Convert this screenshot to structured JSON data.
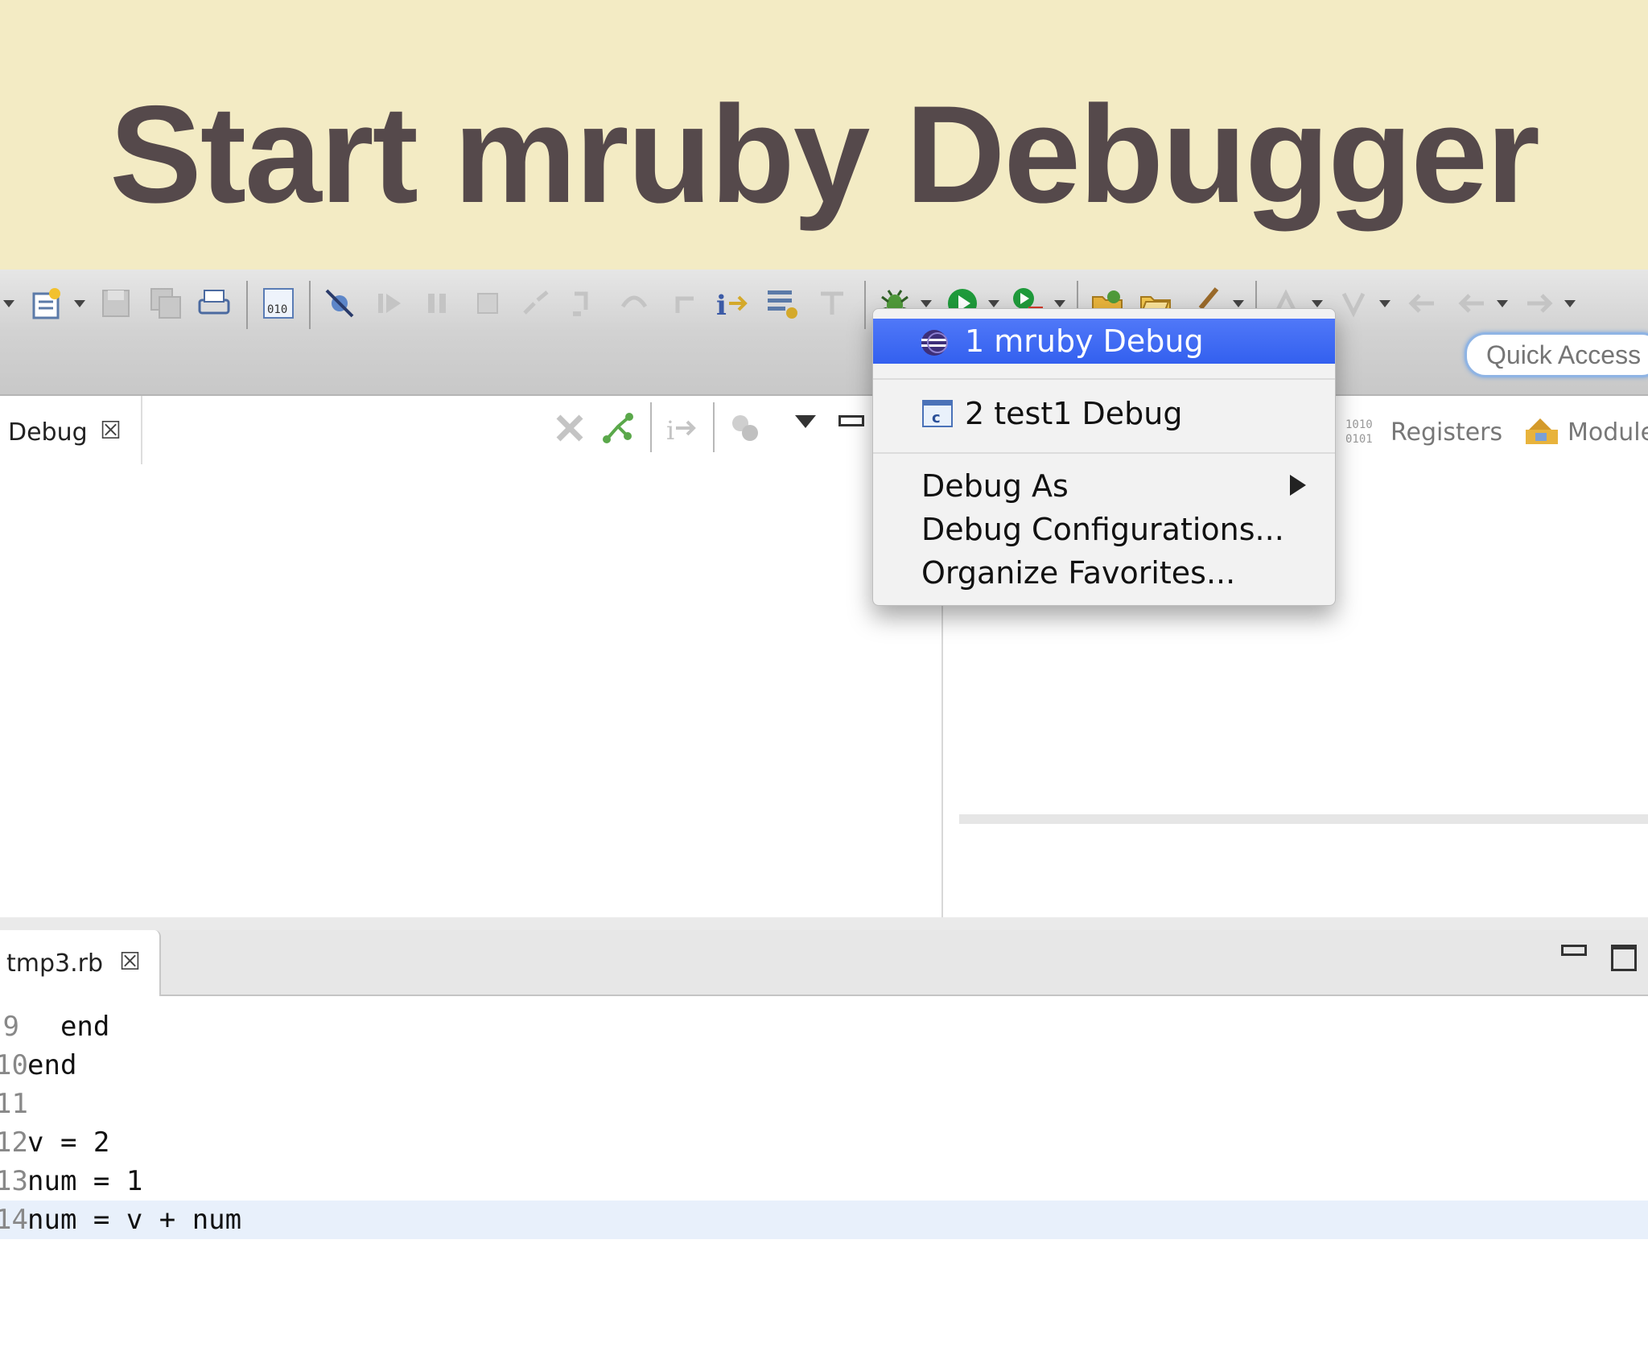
{
  "slide": {
    "title": "Start mruby Debugger"
  },
  "toolbar": {
    "quick_access_placeholder": "Quick Access"
  },
  "debug_view": {
    "tab_label": "Debug",
    "tab_close": "☒"
  },
  "right_view": {
    "tabs": [
      "Registers",
      "Modules"
    ]
  },
  "menu": {
    "items": [
      {
        "label": "1 mruby Debug",
        "selected": true
      },
      {
        "label": "2 test1 Debug",
        "selected": false
      },
      {
        "label": "Debug As",
        "has_submenu": true
      },
      {
        "label": "Debug Configurations..."
      },
      {
        "label": "Organize Favorites..."
      }
    ],
    "selected_color": "#3b66f2"
  },
  "editor": {
    "tab_label": "tmp3.rb",
    "tab_close": "☒",
    "lines": [
      {
        "num": "9",
        "text": "  end"
      },
      {
        "num": "10",
        "text": "end"
      },
      {
        "num": "11",
        "text": ""
      },
      {
        "num": "12",
        "text": "v = 2"
      },
      {
        "num": "13",
        "text": "num = 1"
      },
      {
        "num": "14",
        "text": "num = v + num"
      }
    ]
  }
}
